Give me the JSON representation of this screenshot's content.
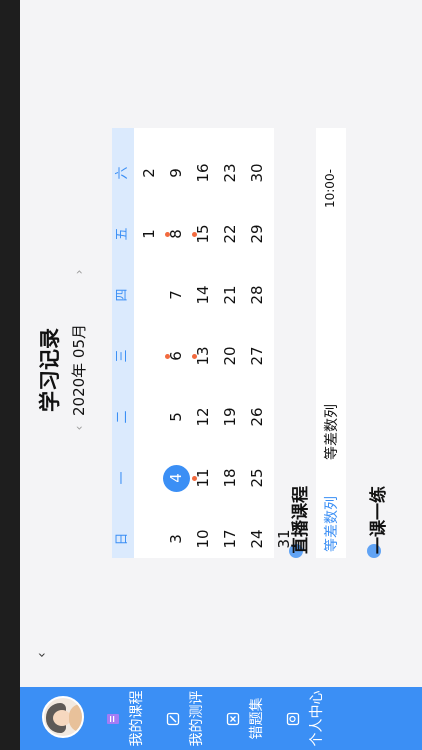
{
  "nav": {
    "items": [
      {
        "label": "我的课程",
        "icon": "book-icon"
      },
      {
        "label": "我的测评",
        "icon": "pen-icon"
      },
      {
        "label": "错题集",
        "icon": "cross-book-icon"
      },
      {
        "label": "个人中心",
        "icon": "search-person-icon"
      }
    ]
  },
  "page": {
    "title": "学习记录",
    "month_label": "2020年  05月",
    "prev_glyph": "‹",
    "next_glyph": "›",
    "collapse_glyph": "‹"
  },
  "calendar": {
    "weekdays": [
      "日",
      "一",
      "二",
      "三",
      "四",
      "五",
      "六"
    ],
    "weeks": [
      [
        "",
        "",
        "",
        "",
        "",
        "1",
        "2"
      ],
      [
        "3",
        "4",
        "5",
        "6",
        "7",
        "8",
        "9"
      ],
      [
        "10",
        "11",
        "12",
        "13",
        "14",
        "15",
        "16"
      ],
      [
        "17",
        "18",
        "19",
        "20",
        "21",
        "22",
        "23"
      ],
      [
        "24",
        "25",
        "26",
        "27",
        "28",
        "29",
        "30"
      ],
      [
        "31",
        "",
        "",
        "",
        "",
        "",
        ""
      ]
    ],
    "today": "4",
    "marked_days": [
      "6",
      "8",
      "11",
      "13",
      "15"
    ]
  },
  "live": {
    "section_title": "直播课程",
    "tag": "等差数列",
    "name": "等差数列",
    "time": "10:00-"
  },
  "practice": {
    "section_title": "一课一练"
  },
  "colors": {
    "accent": "#3b8ff5",
    "dot": "#f26a3e",
    "week_header_bg": "#dbeafd"
  }
}
